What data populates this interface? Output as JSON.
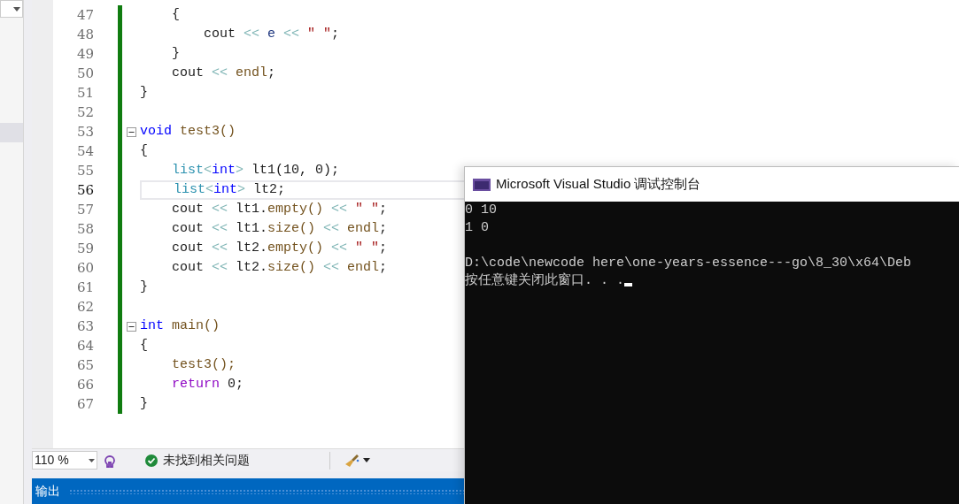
{
  "editor": {
    "lines": [
      {
        "number": "47",
        "current": false,
        "tokens": [
          {
            "kind": "plain",
            "text": "    {"
          }
        ]
      },
      {
        "number": "48",
        "current": false,
        "tokens": [
          {
            "kind": "plain",
            "text": "        cout "
          },
          {
            "kind": "op",
            "text": "<<"
          },
          {
            "kind": "var",
            "text": " e "
          },
          {
            "kind": "op",
            "text": "<<"
          },
          {
            "kind": "str",
            "text": " \" \""
          },
          {
            "kind": "plain",
            "text": ";"
          }
        ]
      },
      {
        "number": "49",
        "current": false,
        "tokens": [
          {
            "kind": "plain",
            "text": "    }"
          }
        ]
      },
      {
        "number": "50",
        "current": false,
        "tokens": [
          {
            "kind": "plain",
            "text": "    cout "
          },
          {
            "kind": "op",
            "text": "<<"
          },
          {
            "kind": "fn",
            "text": " endl"
          },
          {
            "kind": "plain",
            "text": ";"
          }
        ]
      },
      {
        "number": "51",
        "current": false,
        "tokens": [
          {
            "kind": "plain",
            "text": "}"
          }
        ]
      },
      {
        "number": "52",
        "current": false
      },
      {
        "number": "53",
        "current": false,
        "fold_expanded": true,
        "tokens": [
          {
            "kind": "kw",
            "text": "void"
          },
          {
            "kind": "fn",
            "text": " test3()"
          }
        ]
      },
      {
        "number": "54",
        "current": false,
        "tokens": [
          {
            "kind": "plain",
            "text": "{"
          }
        ]
      },
      {
        "number": "55",
        "current": false,
        "tokens": [
          {
            "kind": "type",
            "text": "    list"
          },
          {
            "kind": "op",
            "text": "<"
          },
          {
            "kind": "kw",
            "text": "int"
          },
          {
            "kind": "op",
            "text": ">"
          },
          {
            "kind": "plain",
            "text": " lt1(10, 0);"
          }
        ]
      },
      {
        "number": "56",
        "current": true,
        "tokens": [
          {
            "kind": "type",
            "text": "    list"
          },
          {
            "kind": "op",
            "text": "<"
          },
          {
            "kind": "kw",
            "text": "int"
          },
          {
            "kind": "op",
            "text": ">"
          },
          {
            "kind": "plain",
            "text": " lt2;"
          }
        ]
      },
      {
        "number": "57",
        "current": false,
        "tokens": [
          {
            "kind": "plain",
            "text": "    cout "
          },
          {
            "kind": "op",
            "text": "<<"
          },
          {
            "kind": "plain",
            "text": " lt1."
          },
          {
            "kind": "fn",
            "text": "empty()"
          },
          {
            "kind": "op",
            "text": " <<"
          },
          {
            "kind": "str",
            "text": " \" \""
          },
          {
            "kind": "plain",
            "text": ";"
          }
        ]
      },
      {
        "number": "58",
        "current": false,
        "tokens": [
          {
            "kind": "plain",
            "text": "    cout "
          },
          {
            "kind": "op",
            "text": "<<"
          },
          {
            "kind": "plain",
            "text": " lt1."
          },
          {
            "kind": "fn",
            "text": "size()"
          },
          {
            "kind": "op",
            "text": " <<"
          },
          {
            "kind": "fn",
            "text": " endl"
          },
          {
            "kind": "plain",
            "text": ";"
          }
        ]
      },
      {
        "number": "59",
        "current": false,
        "tokens": [
          {
            "kind": "plain",
            "text": "    cout "
          },
          {
            "kind": "op",
            "text": "<<"
          },
          {
            "kind": "plain",
            "text": " lt2."
          },
          {
            "kind": "fn",
            "text": "empty()"
          },
          {
            "kind": "op",
            "text": " <<"
          },
          {
            "kind": "str",
            "text": " \" \""
          },
          {
            "kind": "plain",
            "text": ";"
          }
        ]
      },
      {
        "number": "60",
        "current": false,
        "tokens": [
          {
            "kind": "plain",
            "text": "    cout "
          },
          {
            "kind": "op",
            "text": "<<"
          },
          {
            "kind": "plain",
            "text": " lt2."
          },
          {
            "kind": "fn",
            "text": "size()"
          },
          {
            "kind": "op",
            "text": " <<"
          },
          {
            "kind": "fn",
            "text": " endl"
          },
          {
            "kind": "plain",
            "text": ";"
          }
        ]
      },
      {
        "number": "61",
        "current": false,
        "tokens": [
          {
            "kind": "plain",
            "text": "}"
          }
        ]
      },
      {
        "number": "62",
        "current": false
      },
      {
        "number": "63",
        "current": false,
        "fold_expanded": true,
        "tokens": [
          {
            "kind": "kw",
            "text": "int"
          },
          {
            "kind": "fn",
            "text": " main()"
          }
        ]
      },
      {
        "number": "64",
        "current": false,
        "tokens": [
          {
            "kind": "plain",
            "text": "{"
          }
        ]
      },
      {
        "number": "65",
        "current": false,
        "tokens": [
          {
            "kind": "fn",
            "text": "    test3();"
          }
        ]
      },
      {
        "number": "66",
        "current": false,
        "tokens": [
          {
            "kind": "ctrl",
            "text": "    return"
          },
          {
            "kind": "plain",
            "text": " 0;"
          }
        ]
      },
      {
        "number": "67",
        "current": false,
        "tokens": [
          {
            "kind": "plain",
            "text": "}"
          }
        ]
      }
    ]
  },
  "status_bar": {
    "zoom": "110 %",
    "issues": "未找到相关问题"
  },
  "output_panel": {
    "title": "输出"
  },
  "console": {
    "title": "Microsoft Visual Studio 调试控制台",
    "lines": [
      {
        "text": "0 10",
        "blank_before": false
      },
      {
        "text": "1 0",
        "blank_before": false
      },
      {
        "text": "D:\\code\\newcode here\\one-years-essence---go\\8_30\\x64\\Deb",
        "blank_before": true
      },
      {
        "text": "按任意键关闭此窗口. . .",
        "blank_before": false
      }
    ]
  }
}
